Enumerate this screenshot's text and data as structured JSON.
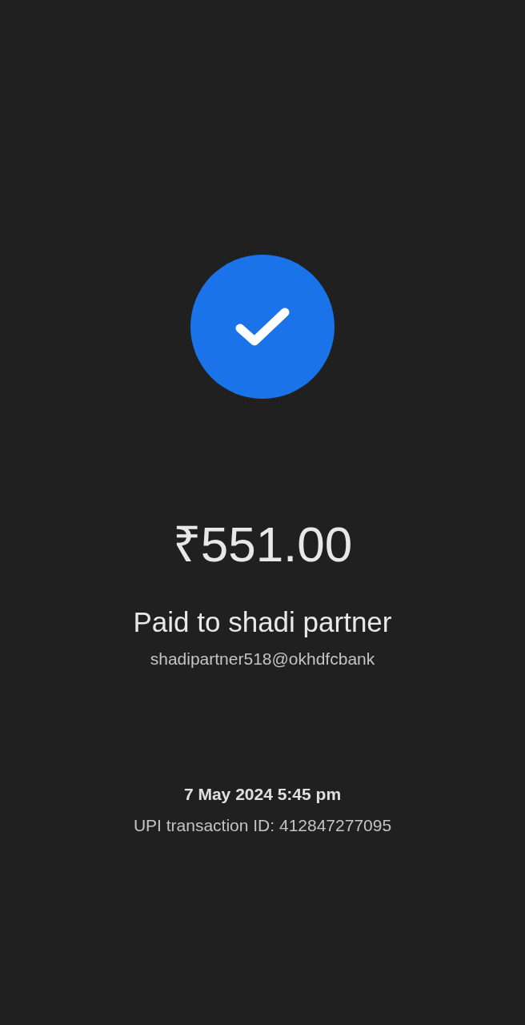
{
  "status": {
    "kind": "success"
  },
  "amount": "₹551.00",
  "paid_to": "Paid to shadi partner",
  "upi_id": "shadipartner518@okhdfcbank",
  "date_time": "7 May 2024 5:45 pm",
  "transaction_id": "UPI transaction ID: 412847277095"
}
